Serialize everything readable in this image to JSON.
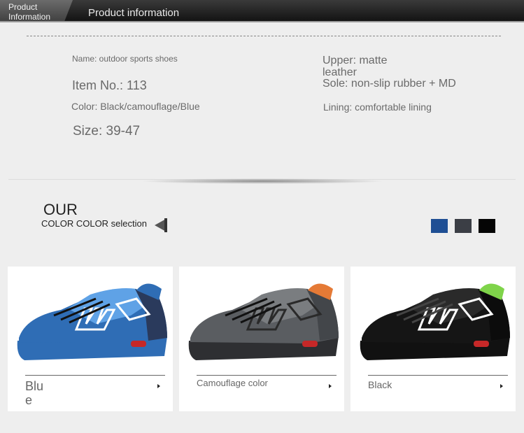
{
  "header": {
    "tab_line1": "Product",
    "tab_line2": "Information",
    "title": "Product information"
  },
  "specs": {
    "name": "Name: outdoor sports shoes",
    "item_no": "Item No.: 113",
    "color": "Color: Black/camouflage/Blue",
    "size": "Size: 39-47",
    "upper_line1": "Upper: matte",
    "upper_line2": "leather",
    "sole": "Sole: non-slip rubber + MD",
    "lining": "Lining: comfortable lining"
  },
  "colors_section": {
    "heading": "OUR",
    "subheading": "COLOR COLOR selection",
    "swatch_colors": [
      "#1f4f94",
      "#3b3e45",
      "#050505"
    ]
  },
  "cards": [
    {
      "label_line1": "Blu",
      "label_line2": "e",
      "upper": "#2f6db5",
      "accent": "#5fa2e6",
      "panel": "#2a3a5c",
      "collar": "#2f6db5",
      "sole": "#2f6db5"
    },
    {
      "label": "Camouflage color",
      "upper": "#5a5d61",
      "accent": "#7a7d80",
      "panel": "#43464a",
      "collar": "#e57a36",
      "sole": "#2e2f32"
    },
    {
      "label": "Black",
      "upper": "#151515",
      "accent": "#2a2a2a",
      "panel": "#0c0c0c",
      "collar": "#7fd44a",
      "sole": "#111111"
    }
  ]
}
